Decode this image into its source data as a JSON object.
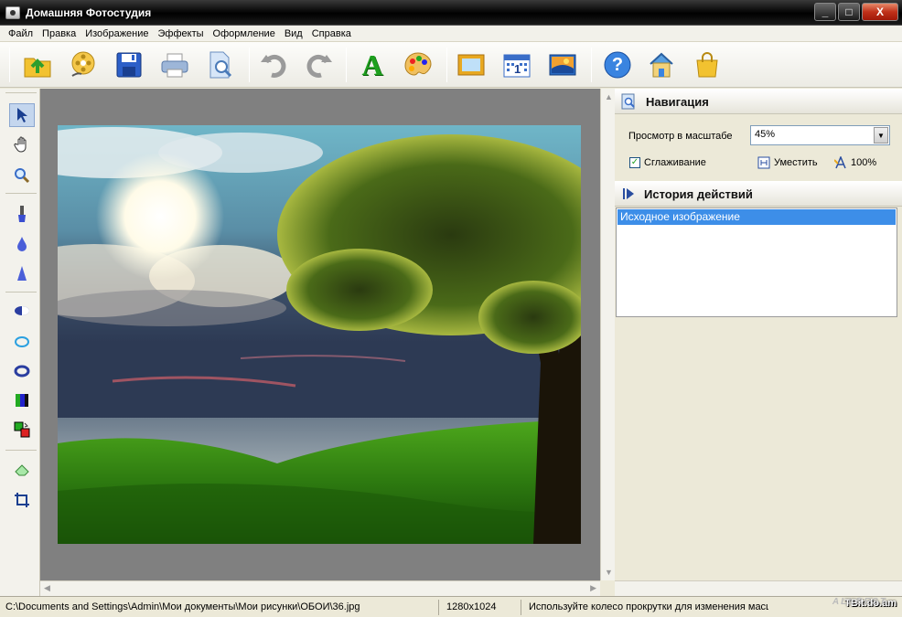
{
  "window": {
    "title": "Домашняя Фотостудия",
    "buttons": {
      "minimize": "_",
      "maximize": "□",
      "close": "X"
    }
  },
  "menu": {
    "items": [
      "Файл",
      "Правка",
      "Изображение",
      "Эффекты",
      "Оформление",
      "Вид",
      "Справка"
    ]
  },
  "toolbar": {
    "icons": [
      "open-icon",
      "film-reel-icon",
      "save-icon",
      "print-icon",
      "search-document-icon",
      "undo-icon",
      "redo-icon",
      "text-icon",
      "palette-icon",
      "frame-icon",
      "calendar-icon",
      "postcard-icon",
      "help-icon",
      "home-icon",
      "shopping-bag-icon"
    ],
    "text_icon_glyph": "A",
    "help_icon_glyph": "?",
    "calendar_icon_glyph": "1"
  },
  "tools": [
    "select-arrow-icon",
    "hand-icon",
    "zoom-icon",
    "brush-icon",
    "drop-icon",
    "sharpen-icon",
    "ellipse-select-icon",
    "lasso-oval-icon",
    "ring-icon",
    "color-levels-icon",
    "color-swap-icon",
    "eraser-icon",
    "crop-icon"
  ],
  "navigation": {
    "title": "Навигация",
    "zoom_label": "Просмотр в масштабе",
    "zoom_value": "45%",
    "smoothing_label": "Сглаживание",
    "smoothing_checked": true,
    "fit_label": "Уместить",
    "full_label": "100%"
  },
  "history": {
    "title": "История действий",
    "items": [
      "Исходное изображение"
    ]
  },
  "status": {
    "path": "C:\\Documents and Settings\\Admin\\Мои документы\\Мои рисунки\\ОБОИ\\36.jpg",
    "dimensions": "1280x1024",
    "hint": "Используйте колесо прокрутки для изменения масшт",
    "watermark": "TBit.do.am",
    "watermark_logo": "ALLBEST"
  },
  "colors": {
    "selection": "#3d8ee8",
    "canvas_bg": "#808080",
    "titlebar": "#0a0a0a"
  }
}
